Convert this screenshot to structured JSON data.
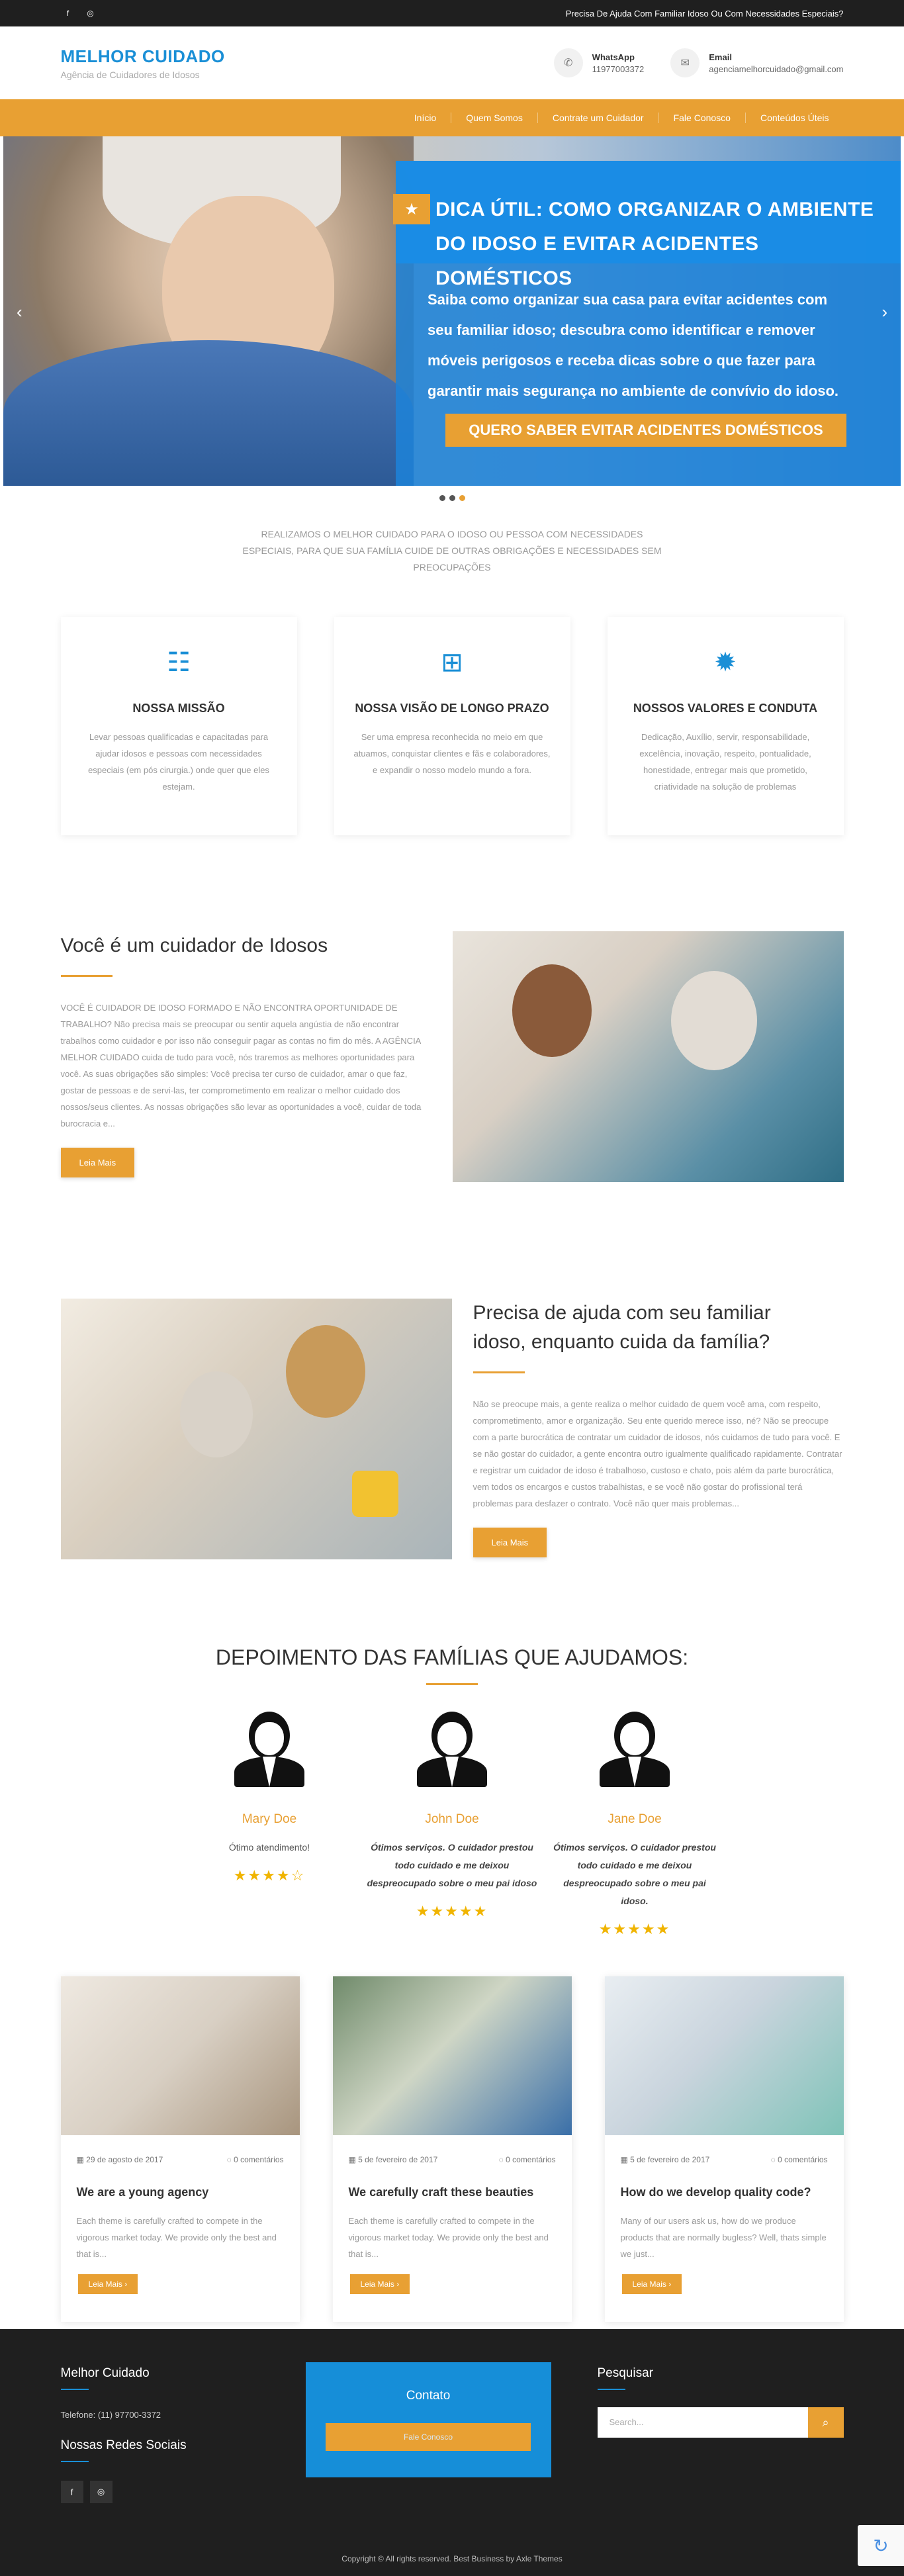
{
  "topbar": {
    "icons": [
      "facebook-icon",
      "instagram-icon"
    ],
    "message": "Precisa De Ajuda Com Familiar Idoso Ou Com Necessidades Especiais?"
  },
  "header": {
    "title": "MELHOR CUIDADO",
    "subtitle": "Agência de Cuidadores de Idosos",
    "whatsapp_label": "WhatsApp",
    "whatsapp_value": "11977003372",
    "email_label": "Email",
    "email_value": "agenciamelhorcuidado@gmail.com"
  },
  "nav": {
    "items": [
      "Início",
      "Quem Somos",
      "Contrate um Cuidador",
      "Fale Conosco",
      "Conteúdos Úteis"
    ]
  },
  "hero": {
    "title_line1": "DICA ÚTIL:  COMO ORGANIZAR O AMBIENTE",
    "title_line2": "DO IDOSO E EVITAR ACIDENTES DOMÉSTICOS",
    "body_line1": "Saiba como organizar sua casa para evitar acidentes com",
    "body_line2": "seu familiar idoso; descubra como identificar e remover",
    "body_line3": "móveis perigosos e receba dicas sobre o que fazer para",
    "body_line4": "garantir mais segurança no ambiente de convívio do idoso.",
    "cta": "QUERO SABER EVITAR ACIDENTES DOMÉSTICOS",
    "active_slide": 3,
    "slides": 3
  },
  "intro": "REALIZAMOS O MELHOR CUIDADO PARA O IDOSO OU PESSOA COM NECESSIDADES ESPECIAIS, PARA QUE SUA FAMÍLIA CUIDE DE OUTRAS OBRIGAÇÕES E NECESSIDADES SEM PREOCUPAÇÕES",
  "features": [
    {
      "icon": "checklist-icon",
      "title": "NOSSA MISSÃO",
      "text": "Levar pessoas qualificadas e capacitadas para ajudar idosos e pessoas com necessidades especiais (em pós cirurgia.) onde quer que eles estejam."
    },
    {
      "icon": "sitemap-icon",
      "title": "NOSSA VISÃO DE LONGO PRAZO",
      "text": "Ser uma empresa reconhecida no meio em que atuamos, conquistar clientes e fãs e colaboradores, e expandir o nosso modelo mundo a fora."
    },
    {
      "icon": "badge-icon",
      "title": "NOSSOS VALORES E CONDUTA",
      "text": "Dedicação, Auxílio, servir, responsabilidade, excelência, inovação, respeito, pontualidade, honestidade, entregar mais que prometido, criatividade na solução de problemas"
    }
  ],
  "block1": {
    "title": "Você é um cuidador de Idosos",
    "text": "VOCÊ É CUIDADOR DE IDOSO FORMADO E NÃO ENCONTRA OPORTUNIDADE DE TRABALHO? Não precisa mais se preocupar ou sentir aquela angústia de não encontrar trabalhos como cuidador e por isso não conseguir pagar as contas no fim do mês. A AGÊNCIA MELHOR CUIDADO cuida de tudo para você, nós traremos as melhores oportunidades para você. As suas obrigações são simples: Você precisa ter curso de cuidador, amar o que faz, gostar de pessoas e de servi-las, ter comprometimento em realizar o melhor cuidado dos nossos/seus clientes. As nossas obrigações são levar as oportunidades a você, cuidar de toda burocracia e...",
    "button": "Leia Mais"
  },
  "block2": {
    "title_line1": "Precisa de ajuda com seu familiar",
    "title_line2": "idoso, enquanto cuida da família?",
    "text": "Não se preocupe mais, a gente realiza o melhor cuidado de quem você ama, com respeito, comprometimento, amor e organização. Seu ente querido merece isso, né? Não se preocupe com a parte burocrática de contratar um cuidador de idosos, nós cuidamos de tudo para você. E se não gostar do cuidador, a gente encontra outro igualmente qualificado rapidamente. Contratar e registrar um cuidador de idoso é trabalhoso, custoso e chato, pois além da parte burocrática, vem todos os encargos e custos trabalhistas, e se você não gostar do profissional terá problemas para desfazer o contrato. Você não quer mais problemas...",
    "button": "Leia Mais"
  },
  "testimonials": {
    "title": "DEPOIMENTO DAS FAMÍLIAS QUE AJUDAMOS:",
    "items": [
      {
        "name": "Mary Doe",
        "quote": "Ótimo atendimento!",
        "rating": 4,
        "max": 5
      },
      {
        "name": "John Doe",
        "quote": "Ótimos serviços. O cuidador prestou todo cuidado e me deixou despreocupado sobre o meu pai idoso",
        "rating": 5,
        "max": 5
      },
      {
        "name": "Jane Doe",
        "quote": "Ótimos serviços. O cuidador prestou todo cuidado e me deixou despreocupado sobre o meu pai idoso.",
        "rating": 5,
        "max": 5
      }
    ]
  },
  "posts": [
    {
      "date": "29 de agosto de 2017",
      "comments": "0 comentários",
      "title": "We are a young agency",
      "excerpt": "Each theme is carefully crafted to compete in the vigorous market today. We provide only the best and that is...",
      "button": "Leia Mais"
    },
    {
      "date": "5 de fevereiro de 2017",
      "comments": "0 comentários",
      "title": "We carefully craft these beauties",
      "excerpt": "Each theme is carefully crafted to compete in the vigorous market today. We provide only the best and that is...",
      "button": "Leia Mais"
    },
    {
      "date": "5 de fevereiro de 2017",
      "comments": "0 comentários",
      "title": "How do we develop quality code?",
      "excerpt": "Many of our users ask us, how do we produce products that are normally bugless? Well, thats simple we just...",
      "button": "Leia Mais"
    }
  ],
  "footer": {
    "col1_title": "Melhor Cuidado",
    "phone": "Telefone: (11) 97700-3372",
    "social_title": "Nossas Redes Sociais",
    "contact_title": "Contato",
    "contact_button": "Fale Conosco",
    "search_title": "Pesquisar",
    "search_placeholder": "Search...",
    "copyright": "Copyright © All rights reserved.  Best Business by Axle Themes"
  },
  "colors": {
    "accent": "#e8a033",
    "brand": "#1a8fd6",
    "dark": "#1f1f1f"
  }
}
